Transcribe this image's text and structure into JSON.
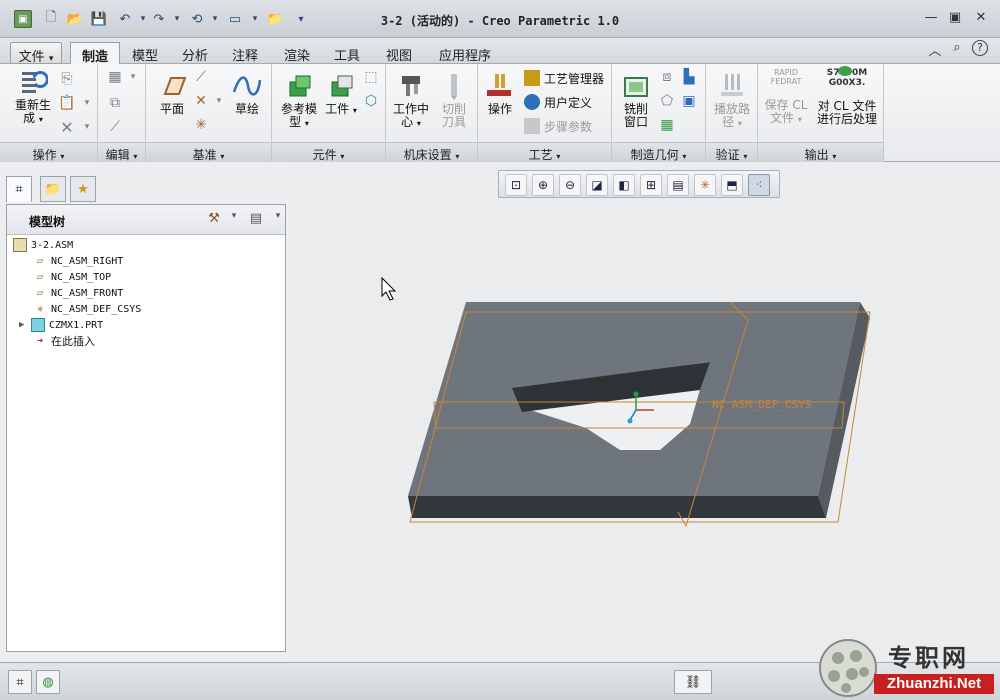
{
  "window": {
    "title": "3-2 (活动的) - Creo Parametric 1.0"
  },
  "tabs": [
    {
      "label": "文件",
      "dropdown": "▾"
    },
    {
      "label": "制造"
    },
    {
      "label": "模型"
    },
    {
      "label": "分析"
    },
    {
      "label": "注释"
    },
    {
      "label": "渲染"
    },
    {
      "label": "工具"
    },
    {
      "label": "视图"
    },
    {
      "label": "应用程序"
    }
  ],
  "ribbon": {
    "groups": {
      "operations": "操作",
      "edit": "编辑",
      "datum": "基准",
      "components": "元件",
      "machine_setup": "机床设置",
      "process": "工艺",
      "mfg_geometry": "制造几何",
      "verify": "验证",
      "output": "输出"
    },
    "buttons": {
      "regenerate": "重新生\n成",
      "plane": "平面",
      "sketch": "草绘",
      "reference_model": "参考模\n型",
      "workpiece": "工件",
      "work_center": "工作中\n心",
      "cutting_tool": "切削\n刀具",
      "operation": "操作",
      "process_manager": "工艺管理器",
      "user_defined": "用户定义",
      "step_params": "步骤参数",
      "mill_window": "铣削\n窗口",
      "play_path": "播放路\n径",
      "save_cl": "保存 CL\n文件",
      "post_process": "对 CL 文件\n进行后处理",
      "rapid_fedrat": "RAPID\nFEDRAT",
      "s7000": "S7000M\nG00X3."
    }
  },
  "model_tree": {
    "title": "模型树",
    "items": [
      {
        "label": "3-2.ASM",
        "icon": "assembly-icon"
      },
      {
        "label": "NC_ASM_RIGHT",
        "icon": "datum-plane-icon"
      },
      {
        "label": "NC_ASM_TOP",
        "icon": "datum-plane-icon"
      },
      {
        "label": "NC_ASM_FRONT",
        "icon": "datum-plane-icon"
      },
      {
        "label": "NC_ASM_DEF_CSYS",
        "icon": "csys-icon"
      },
      {
        "label": "CZMX1.PRT",
        "icon": "part-icon"
      },
      {
        "label": "在此插入",
        "icon": "insert-arrow-icon"
      }
    ]
  },
  "graphics": {
    "csys_label": "NC_ASM_DEF_CSYS"
  },
  "watermark": {
    "cn": "专职网",
    "en": "Zhuanzhi.Net"
  },
  "colors": {
    "accent": "#2f6fb8",
    "model": "#6e747b",
    "datum": "#d08a3a"
  }
}
